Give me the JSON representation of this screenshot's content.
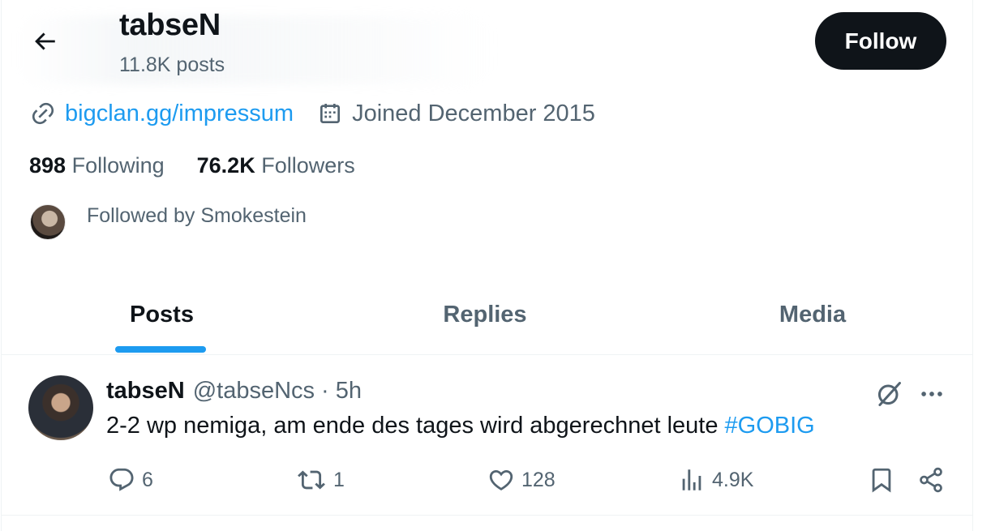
{
  "header": {
    "name": "tabseN",
    "post_count": "11.8K posts",
    "follow_label": "Follow"
  },
  "profile": {
    "website": "bigclan.gg/impressum",
    "joined": "Joined December 2015",
    "following_count": "898",
    "following_label": "Following",
    "followers_count": "76.2K",
    "followers_label": "Followers",
    "followed_by": "Followed by Smokestein"
  },
  "tabs": [
    {
      "label": "Posts",
      "active": true
    },
    {
      "label": "Replies",
      "active": false
    },
    {
      "label": "Media",
      "active": false
    }
  ],
  "post": {
    "author_name": "tabseN",
    "author_handle": "@tabseNcs",
    "separator": "·",
    "time": "5h",
    "text": "2-2 wp nemiga, am ende des tages wird abgerechnet leute ",
    "hashtag": "#GOBIG",
    "replies": "6",
    "reposts": "1",
    "likes": "128",
    "views": "4.9K"
  },
  "colors": {
    "accent": "#1d9bf0",
    "text_primary": "#0f1419",
    "text_secondary": "#536471",
    "follow_button_bg": "#0f1419",
    "divider": "#eff3f4"
  },
  "icons": [
    "back-arrow-icon",
    "link-icon",
    "calendar-icon",
    "grok-icon",
    "more-icon",
    "reply-icon",
    "repost-icon",
    "like-icon",
    "views-icon",
    "bookmark-icon",
    "share-icon"
  ]
}
